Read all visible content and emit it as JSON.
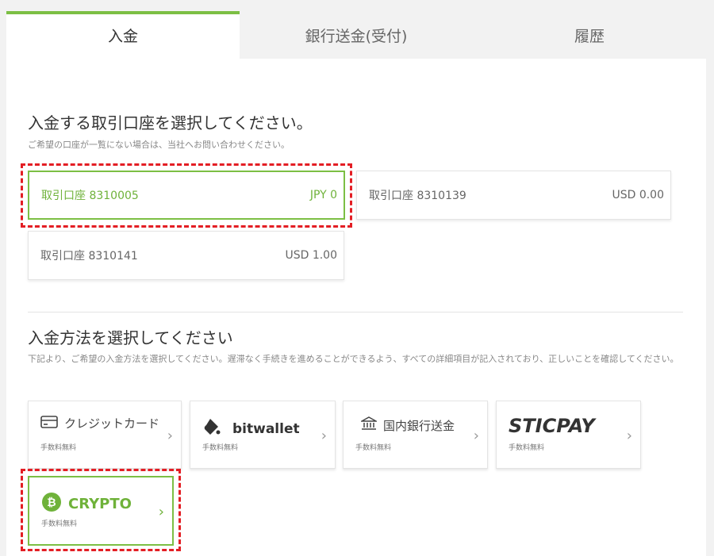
{
  "tabs": [
    {
      "label": "入金",
      "active": true
    },
    {
      "label": "銀行送金(受付)",
      "active": false
    },
    {
      "label": "履歴",
      "active": false
    }
  ],
  "account_section": {
    "title": "入金する取引口座を選択してください。",
    "subtitle": "ご希望の口座が一覧にない場合は、当社へお問い合わせください。",
    "accounts": [
      {
        "name": "取引口座 8310005",
        "balance": "JPY 0",
        "selected": true
      },
      {
        "name": "取引口座 8310139",
        "balance": "USD 0.00",
        "selected": false
      },
      {
        "name": "取引口座 8310141",
        "balance": "USD 1.00",
        "selected": false
      }
    ]
  },
  "method_section": {
    "title": "入金方法を選択してください",
    "description": "下記より、ご希望の入金方法を選択してください。遅滞なく手続きを進めることができるよう、すべての詳細項目が記入されており、正しいことを確認してください。",
    "methods": [
      {
        "label": "クレジットカード",
        "fee": "手数料無料",
        "icon": "credit-card-icon"
      },
      {
        "label": "bitwallet",
        "fee": "手数料無料",
        "icon": "bitwallet-logo-icon"
      },
      {
        "label": "国内銀行送金",
        "fee": "手数料無料",
        "icon": "bank-icon"
      },
      {
        "label": "STICPAY",
        "fee": "手数料無料",
        "icon": "sticpay-logo"
      },
      {
        "label": "CRYPTO",
        "fee": "手数料無料",
        "icon": "bitcoin-icon",
        "selected": true
      }
    ],
    "chevron": "›"
  },
  "colors": {
    "accent": "#7cbf44",
    "highlight": "#e31e24"
  }
}
